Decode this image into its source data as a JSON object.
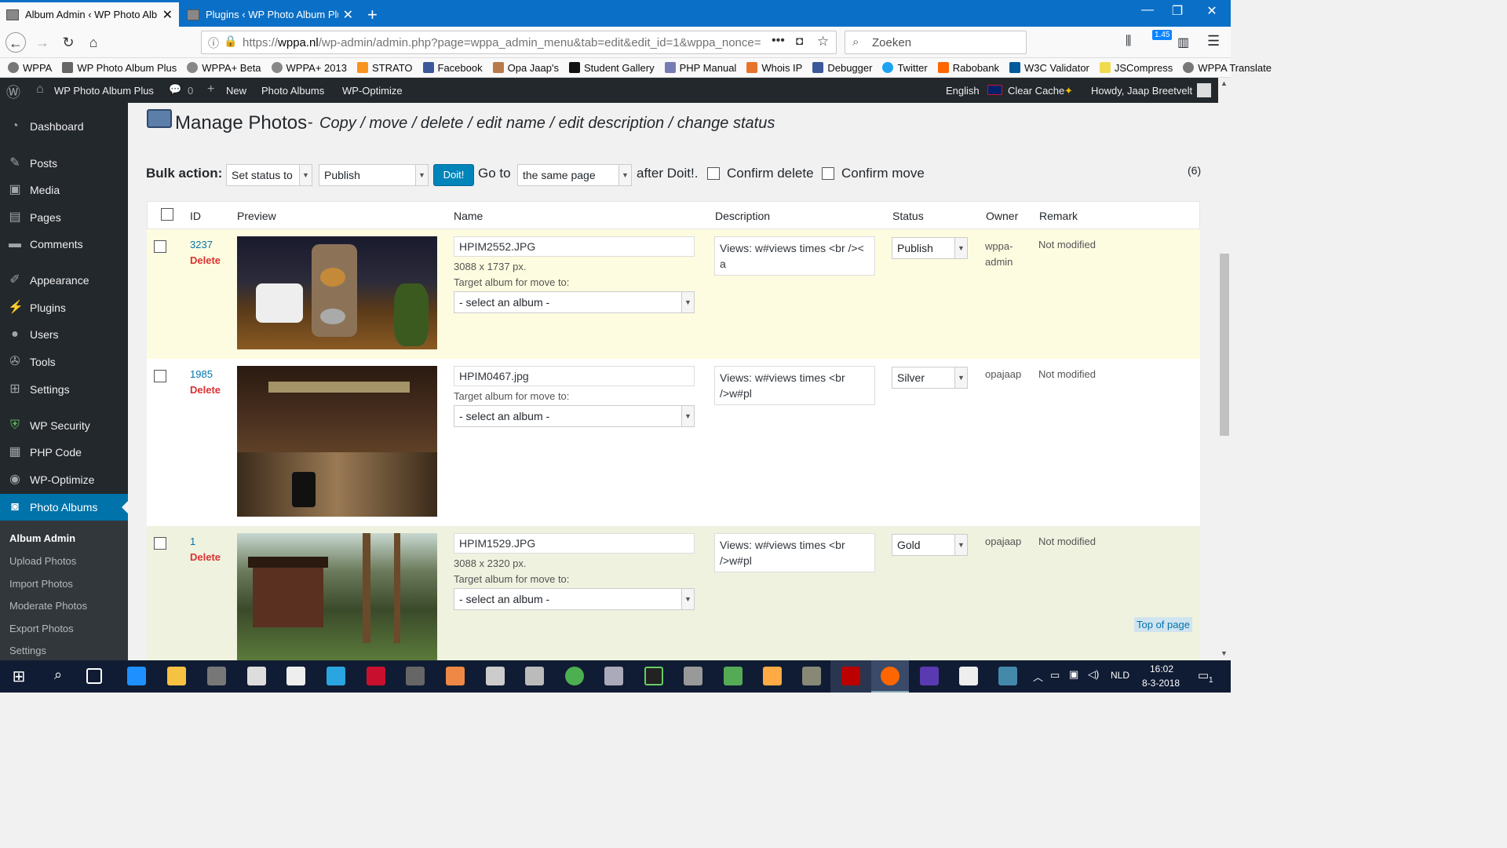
{
  "browser": {
    "tabs": [
      {
        "title": "Album Admin ‹ WP Photo Album Plus",
        "active": true
      },
      {
        "title": "Plugins ‹ WP Photo Album Plus",
        "active": false
      }
    ],
    "url_prefix": "https://",
    "url_domain": "wppa.nl",
    "url_rest": "/wp-admin/admin.php?page=wppa_admin_menu&tab=edit&edit_id=1&wppa_nonce=",
    "search_placeholder": "Zoeken",
    "badge": "1.45",
    "bookmarks": [
      "WPPA",
      "WP Photo Album Plus",
      "WPPA+ Beta",
      "WPPA+ 2013",
      "STRATO",
      "Facebook",
      "Opa Jaap's",
      "Student Gallery",
      "PHP Manual",
      "Whois IP",
      "Debugger",
      "Twitter",
      "Rabobank",
      "W3C Validator",
      "JSCompress",
      "WPPA Translate"
    ]
  },
  "adminbar": {
    "site": "WP Photo Album Plus",
    "comments": "0",
    "new": "New",
    "photo_albums": "Photo Albums",
    "optimize": "WP-Optimize",
    "language": "English",
    "clear_cache": "Clear Cache",
    "howdy": "Howdy, Jaap Breetvelt"
  },
  "sidebar": {
    "items": [
      "Dashboard",
      "Posts",
      "Media",
      "Pages",
      "Comments",
      "Appearance",
      "Plugins",
      "Users",
      "Tools",
      "Settings",
      "WP Security",
      "PHP Code",
      "WP-Optimize",
      "Photo Albums"
    ],
    "submenu": [
      "Album Admin",
      "Upload Photos",
      "Import Photos",
      "Moderate Photos",
      "Export Photos",
      "Settings"
    ]
  },
  "page": {
    "title": "Manage Photos",
    "dash": "-",
    "subtitle": "Copy / move / delete / edit name / edit description / change status",
    "bulk_label": "Bulk action:",
    "bulk_action": "Set status to",
    "bulk_status": "Publish",
    "doit": "Doit!",
    "goto_label": "Go to",
    "goto_value": "the same page",
    "after": "after Doit!.",
    "confirm_delete": "Confirm delete",
    "confirm_move": "Confirm move",
    "count": "(6)",
    "top_of_page": "Top of page"
  },
  "table": {
    "headers": [
      "ID",
      "Preview",
      "Name",
      "Description",
      "Status",
      "Owner",
      "Remark"
    ],
    "rows": [
      {
        "id": "3237",
        "delete": "Delete",
        "name": "HPIM2552.JPG",
        "size": "3088 x 1737 px.",
        "target": "Target album for move to:",
        "album": "- select an album -",
        "description": "Views: w#views times <br />< a",
        "status": "Publish",
        "owner": "wppa-admin",
        "remark": "Not modified"
      },
      {
        "id": "1985",
        "delete": "Delete",
        "name": "HPIM0467.jpg",
        "size": "",
        "target": "Target album for move to:",
        "album": "- select an album -",
        "description": "Views: w#views times <br />w#pl",
        "status": "Silver",
        "owner": "opajaap",
        "remark": "Not modified"
      },
      {
        "id": "1",
        "delete": "Delete",
        "name": "HPIM1529.JPG",
        "size": "3088 x 2320 px.",
        "target": "Target album for move to:",
        "album": "- select an album -",
        "description": "Views: w#views times <br />w#pl",
        "status": "Gold",
        "owner": "opajaap",
        "remark": "Not modified"
      }
    ]
  },
  "taskbar": {
    "language": "NLD",
    "time": "16:02",
    "date": "8-3-2018",
    "notifications": "1"
  },
  "colors": {
    "tabbar": "#0a6fc6",
    "wp_dark": "#23282d",
    "wp_blue": "#0073aa",
    "row_highlight": "#fefce0",
    "row_green": "#eef2df",
    "delete": "#dc3232"
  }
}
